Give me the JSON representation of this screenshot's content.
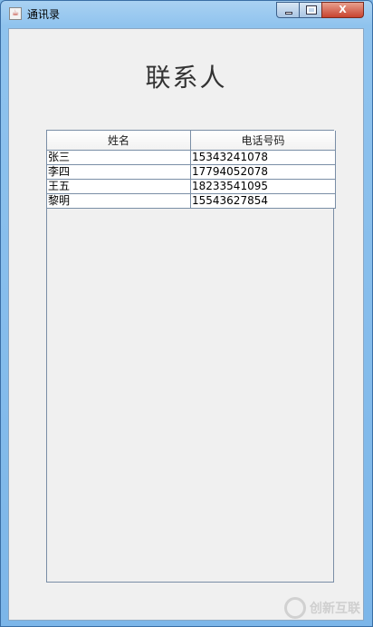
{
  "window": {
    "title": "通讯录",
    "app_icon": "java-icon",
    "controls": {
      "minimize": "minimize-icon",
      "maximize": "maximize-icon",
      "close_label": "X"
    }
  },
  "main": {
    "heading": "联系人",
    "table": {
      "columns": [
        "姓名",
        "电话号码"
      ],
      "rows": [
        [
          "张三",
          "15343241078"
        ],
        [
          "李四",
          "17794052078"
        ],
        [
          "王五",
          "18233541095"
        ],
        [
          "黎明",
          "15543627854"
        ]
      ]
    }
  },
  "watermark": {
    "text": "创新互联"
  },
  "colors": {
    "titlebar": "#a9d1f2",
    "content_bg": "#f0f0f0",
    "grid_line": "#7a8ea6",
    "close_button": "#c8432f"
  }
}
